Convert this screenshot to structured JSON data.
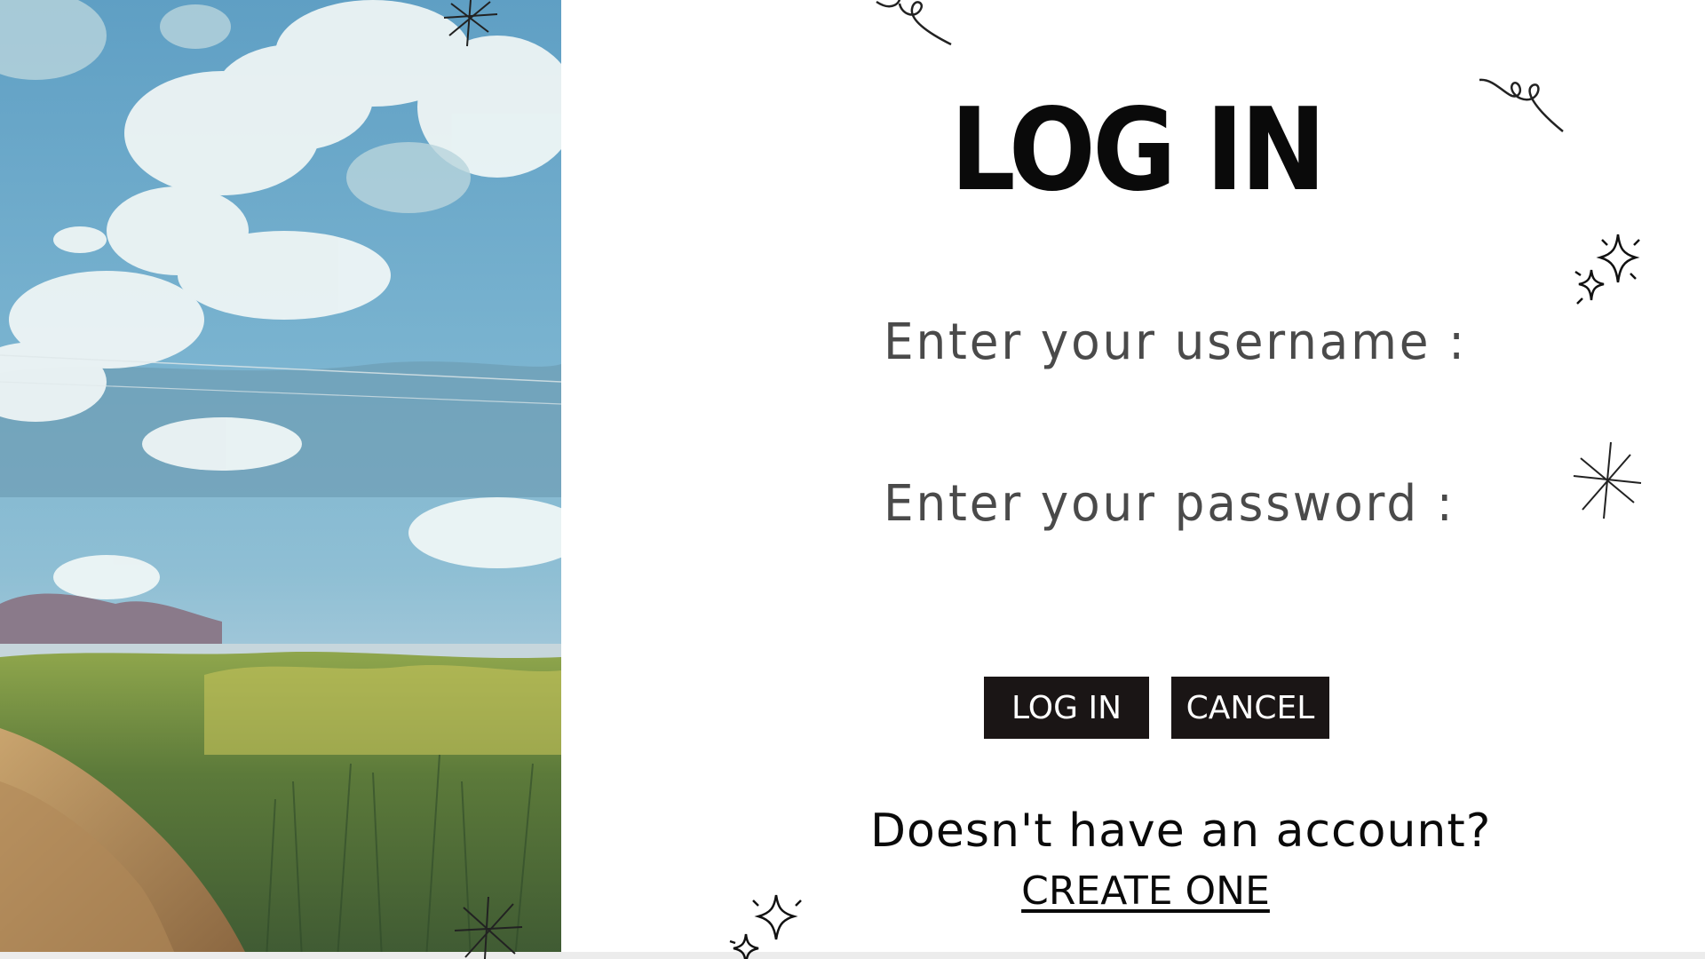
{
  "login_page": {
    "title": "LOG IN",
    "username_label": "Enter your username :",
    "password_label": "Enter your password :",
    "login_button_label": "LOG IN",
    "cancel_button_label": "CANCEL",
    "account_prompt": "Doesn't have an account?",
    "create_account_link": "CREATE ONE"
  },
  "decorations": {
    "icons": [
      "sparkle-icon",
      "asterisk-icon",
      "swirl-icon"
    ]
  },
  "colors": {
    "background": "#ffffff",
    "button_bg": "#1a1515",
    "button_text": "#ffffff",
    "title_text": "#0a0a0a",
    "label_text": "#4a4a4a"
  }
}
